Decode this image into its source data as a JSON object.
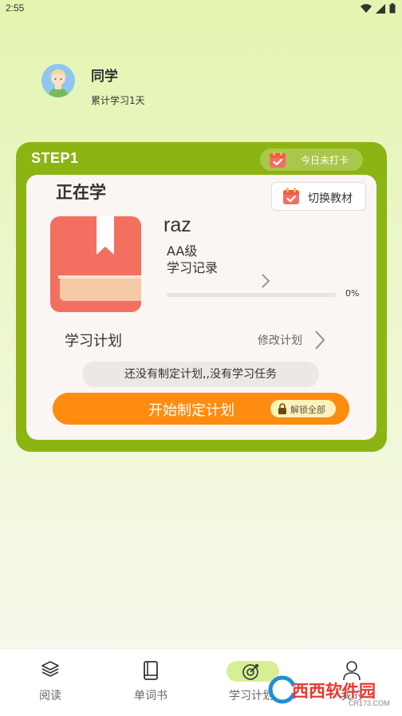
{
  "status_bar": {
    "time": "2:55"
  },
  "profile": {
    "name": "同学",
    "days": "累计学习1天"
  },
  "plan_card": {
    "step": "STEP1",
    "checkin_label": "今日未打卡",
    "studying_title": "正在学",
    "switch_button": "切换教材",
    "book": {
      "title": "raz",
      "level": "AA级",
      "record_link": "学习记录",
      "progress_fraction": 0,
      "progress_label": "0%"
    },
    "plan_label": "学习计划",
    "modify_link": "修改计划",
    "empty_message": "还没有制定计划,,没有学习任务",
    "start_button": "开始制定计划",
    "unlock_label": "解锁全部"
  },
  "bottom_nav": [
    {
      "label": "阅读",
      "icon": "layers-icon"
    },
    {
      "label": "单词书",
      "icon": "book-icon"
    },
    {
      "label": "学习计划",
      "icon": "target-icon",
      "active": true
    },
    {
      "label": "我的",
      "icon": "person-icon"
    }
  ],
  "watermark": {
    "text": "西西软件园",
    "sub": "CR173.COM"
  },
  "colors": {
    "accent_green": "#8cb513",
    "orange": "#fe8c10",
    "book_red": "#f36f60"
  }
}
